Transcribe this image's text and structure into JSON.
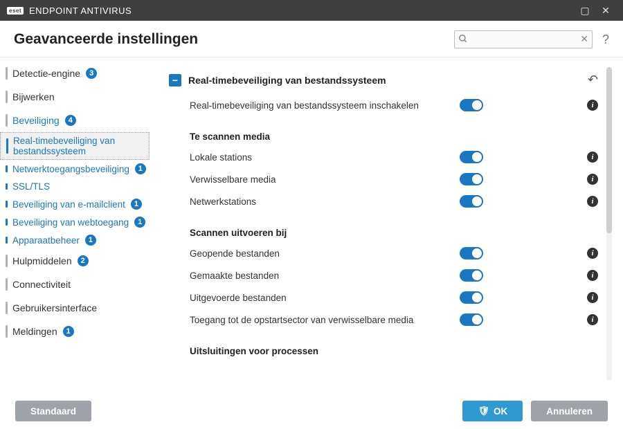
{
  "app": {
    "brand": "eset",
    "title": "ENDPOINT ANTIVIRUS"
  },
  "header": {
    "title": "Geavanceerde instellingen",
    "search_placeholder": ""
  },
  "sidebar": {
    "items": [
      {
        "label": "Detectie-engine",
        "badge": "3"
      },
      {
        "label": "Bijwerken"
      },
      {
        "label": "Beveiliging",
        "badge": "4",
        "active": true,
        "children": [
          {
            "label": "Real-timebeveiliging van bestandssysteem",
            "current": true
          },
          {
            "label": "Netwerktoegangsbeveiliging",
            "badge": "1"
          },
          {
            "label": "SSL/TLS"
          },
          {
            "label": "Beveiliging van e-mailclient",
            "badge": "1"
          },
          {
            "label": "Beveiliging van webtoegang",
            "badge": "1"
          },
          {
            "label": "Apparaatbeheer",
            "badge": "1"
          }
        ]
      },
      {
        "label": "Hulpmiddelen",
        "badge": "2"
      },
      {
        "label": "Connectiviteit"
      },
      {
        "label": "Gebruikersinterface"
      },
      {
        "label": "Meldingen",
        "badge": "1"
      }
    ]
  },
  "panel": {
    "section_title": "Real-timebeveiliging van bestandssysteem",
    "enable_row": {
      "label": "Real-timebeveiliging van bestandssysteem inschakelen"
    },
    "group_media": {
      "title": "Te scannen media",
      "rows": [
        {
          "label": "Lokale stations"
        },
        {
          "label": "Verwisselbare media"
        },
        {
          "label": "Netwerkstations"
        }
      ]
    },
    "group_scanon": {
      "title": "Scannen uitvoeren bij",
      "rows": [
        {
          "label": "Geopende bestanden"
        },
        {
          "label": "Gemaakte bestanden"
        },
        {
          "label": "Uitgevoerde bestanden"
        },
        {
          "label": "Toegang tot de opstartsector van verwisselbare media"
        }
      ]
    },
    "group_excl": {
      "title": "Uitsluitingen voor processen"
    }
  },
  "footer": {
    "default": "Standaard",
    "ok": "OK",
    "cancel": "Annuleren"
  }
}
